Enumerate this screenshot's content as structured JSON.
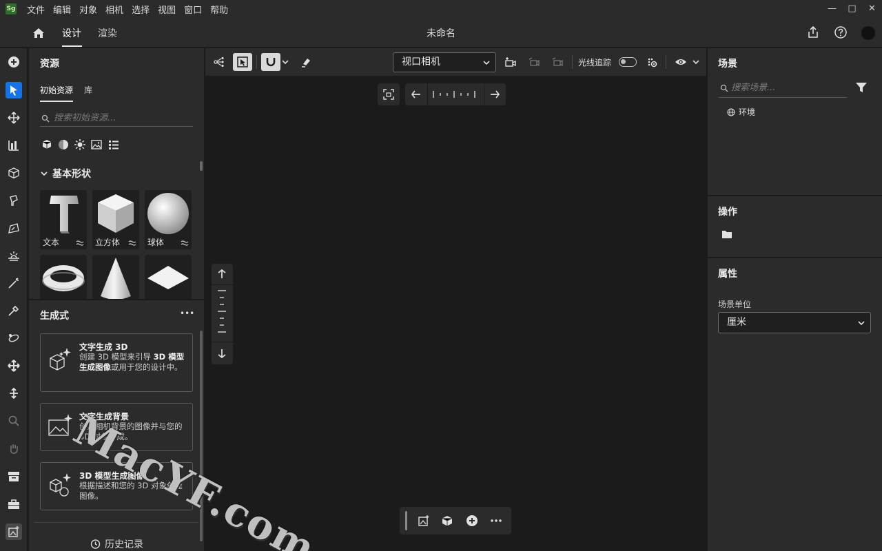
{
  "app": {
    "logo": "Sg"
  },
  "menu": [
    "文件",
    "编辑",
    "对象",
    "相机",
    "选择",
    "视图",
    "窗口",
    "帮助"
  ],
  "window_controls": {
    "minimize": "—",
    "maximize": "□",
    "close": "✕"
  },
  "header": {
    "tabs": [
      {
        "label": "设计",
        "active": true
      },
      {
        "label": "渲染",
        "active": false
      }
    ],
    "doc_title": "未命名"
  },
  "left_tools": [
    "add-icon",
    "select-icon",
    "move-icon",
    "align-icon",
    "cube-icon",
    "paint-bucket-icon",
    "draw-icon",
    "horizon-icon",
    "magic-wand-icon",
    "eyedropper-icon",
    "orbit-icon",
    "pan-icon",
    "dolly-icon",
    "zoom-icon",
    "hand-icon",
    "archive-icon",
    "toolbox-icon",
    "image-add-icon"
  ],
  "assets": {
    "title": "资源",
    "subtabs": [
      "初始资源",
      "库"
    ],
    "search_placeholder": "搜索初始资源...",
    "section_title": "基本形状",
    "shapes": [
      {
        "label": "文本"
      },
      {
        "label": "立方体"
      },
      {
        "label": "球体"
      },
      {
        "label": ""
      },
      {
        "label": ""
      },
      {
        "label": ""
      }
    ]
  },
  "generative": {
    "title": "生成式",
    "more": "•••",
    "cards": [
      {
        "title": "文字生成 3D",
        "desc_pre": "创建 3D 模型来引导 ",
        "desc_bold": "3D 模型生成图像",
        "desc_post": "或用于您的设计中。"
      },
      {
        "title": "文字生成背景",
        "desc_pre": "创建相机背景的图像并与您的 3D 对象合成。",
        "desc_bold": "",
        "desc_post": ""
      },
      {
        "title": "3D 模型生成图像",
        "desc_pre": "根据描述和您的 3D 对象创建图像。",
        "desc_bold": "",
        "desc_post": ""
      }
    ],
    "history": "历史记录"
  },
  "viewport": {
    "camera": "视口相机",
    "raytrace": "光线追踪",
    "raytrace_on": false
  },
  "scene": {
    "title": "场景",
    "search_placeholder": "搜索场景...",
    "items": [
      "环境"
    ]
  },
  "actions": {
    "title": "操作"
  },
  "properties": {
    "title": "属性",
    "unit_label": "场景单位",
    "unit_value": "厘米"
  },
  "watermark": {
    "text": "MacYF.com"
  },
  "colors": {
    "accent": "#1473e6",
    "panel": "#2b2b2b",
    "canvas": "#1b1b1b"
  }
}
